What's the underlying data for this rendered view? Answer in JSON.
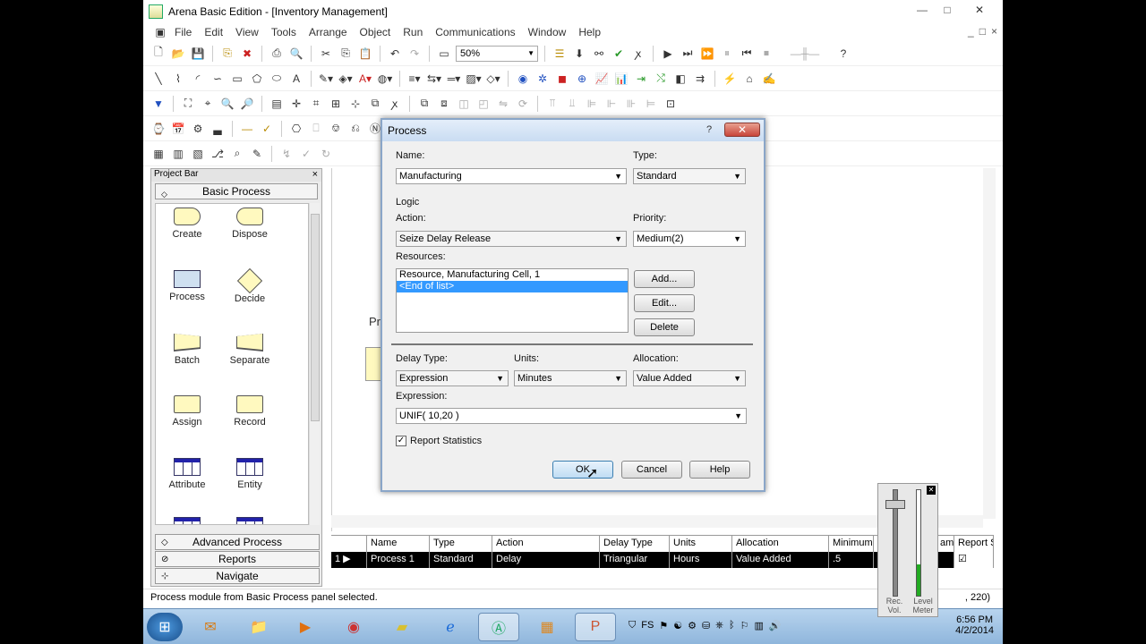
{
  "window": {
    "title": "Arena Basic Edition - [Inventory Management]",
    "minimize": "—",
    "maximize": "□",
    "close": "✕"
  },
  "menubar": {
    "items": [
      "File",
      "Edit",
      "View",
      "Tools",
      "Arrange",
      "Object",
      "Run",
      "Communications",
      "Window",
      "Help"
    ],
    "mdi_buttons": [
      "_",
      "□",
      "×"
    ]
  },
  "toolbar": {
    "zoom": "50%"
  },
  "project_bar": {
    "title": "Project Bar",
    "close": "×",
    "panel": "Basic Process",
    "shapes": [
      {
        "label": "Create",
        "icon": "create-shape-icon"
      },
      {
        "label": "Dispose",
        "icon": "dispose-shape-icon"
      },
      {
        "label": "Process",
        "icon": "process-shape-icon"
      },
      {
        "label": "Decide",
        "icon": "decide-shape-icon"
      },
      {
        "label": "Batch",
        "icon": "batch-shape-icon"
      },
      {
        "label": "Separate",
        "icon": "separate-shape-icon"
      },
      {
        "label": "Assign",
        "icon": "assign-shape-icon"
      },
      {
        "label": "Record",
        "icon": "record-shape-icon"
      },
      {
        "label": "Attribute",
        "icon": "attribute-table-icon"
      },
      {
        "label": "Entity",
        "icon": "entity-table-icon"
      }
    ],
    "bottom_panels": [
      "Advanced Process",
      "Reports",
      "Navigate"
    ]
  },
  "canvas": {
    "partial_label": "Pr"
  },
  "dialog": {
    "title": "Process",
    "help": "?",
    "close": "✕",
    "name_label": "Name:",
    "name_value": "Manufacturing",
    "type_label": "Type:",
    "type_value": "Standard",
    "logic_label": "Logic",
    "action_label": "Action:",
    "action_value": "Seize Delay Release",
    "priority_label": "Priority:",
    "priority_value": "Medium(2)",
    "resources_label": "Resources:",
    "resources": [
      "Resource, Manufacturing Cell, 1",
      "<End of list>"
    ],
    "add_button": "Add...",
    "edit_button": "Edit...",
    "delete_button": "Delete",
    "delay_type_label": "Delay Type:",
    "delay_type_value": "Expression",
    "units_label": "Units:",
    "units_value": "Minutes",
    "allocation_label": "Allocation:",
    "allocation_value": "Value Added",
    "expression_label": "Expression:",
    "expression_value": "UNIF( 10,20 )",
    "report_statistics_label": "Report Statistics",
    "report_statistics_checked": true,
    "ok_button": "OK",
    "cancel_button": "Cancel",
    "help_button": "Help"
  },
  "spreadsheet": {
    "columns": [
      "",
      "Name",
      "Type",
      "Action",
      "Delay Type",
      "Units",
      "Allocation",
      "Minimum",
      "",
      "am",
      "Report St"
    ],
    "row": [
      "1 ▶",
      "Process 1",
      "Standard",
      "Delay",
      "Triangular",
      "Hours",
      "Value Added",
      ".5",
      "",
      "",
      "☑"
    ]
  },
  "status_bar": {
    "message": "Process module from Basic Process panel selected.",
    "coords": ", 220)"
  },
  "volume": {
    "rec_label": "Rec. Vol.",
    "level_label": "Level Meter",
    "level_fraction": 0.3
  },
  "taskbar": {
    "time": "6:56 PM",
    "date": "4/2/2014"
  }
}
